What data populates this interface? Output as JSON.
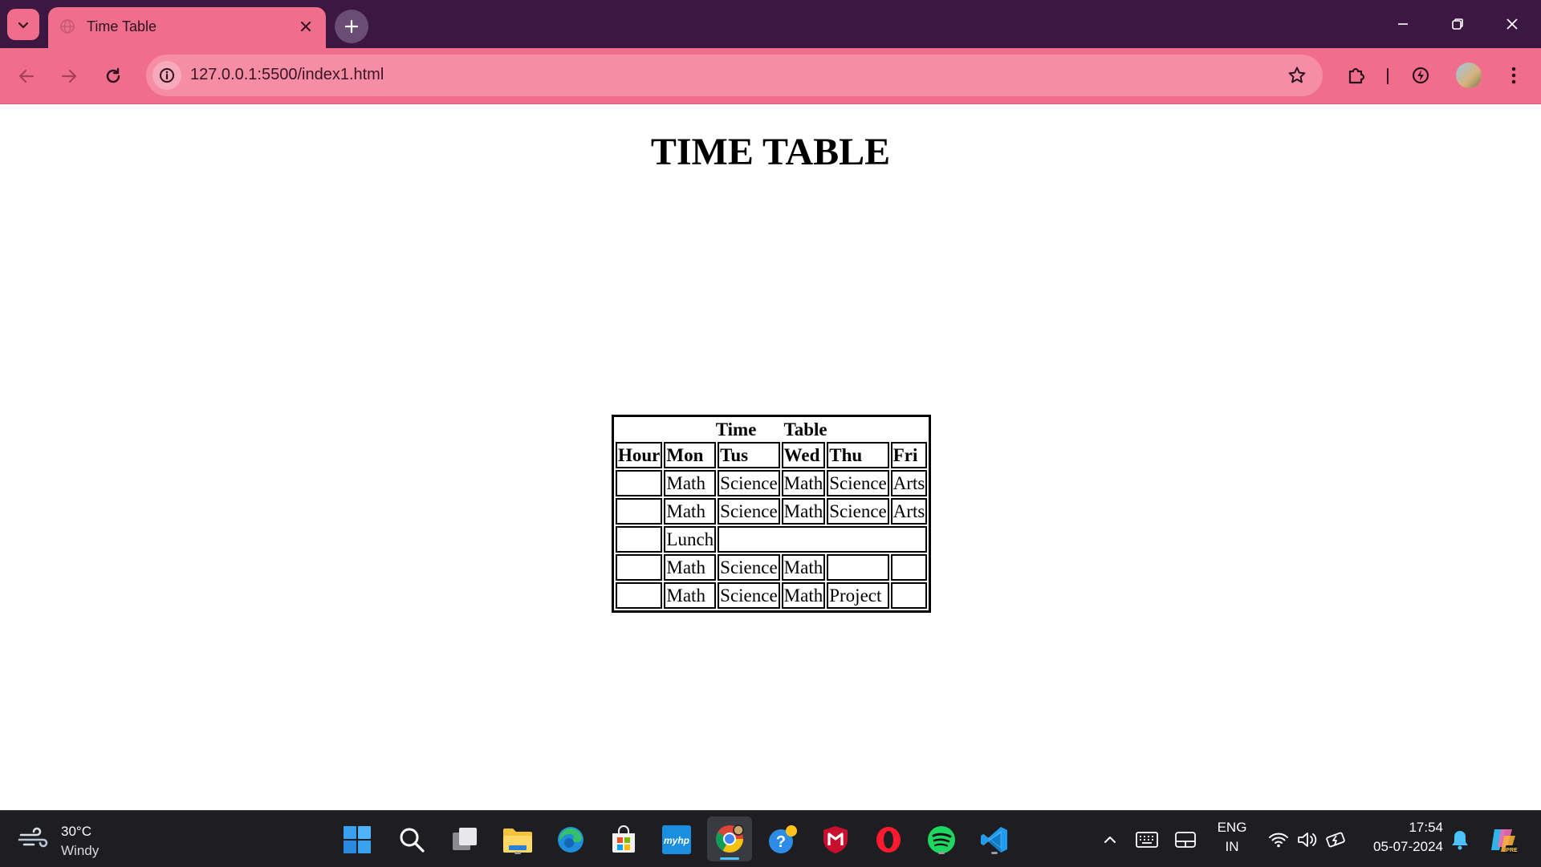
{
  "browser": {
    "tab_title": "Time Table",
    "url": "127.0.0.1:5500/index1.html"
  },
  "page": {
    "heading": "TIME TABLE",
    "table": {
      "caption_part1": "Time",
      "caption_part2": "Table",
      "headers": [
        "Hour",
        "Mon",
        "Tus",
        "Wed",
        "Thu",
        "Fri"
      ],
      "rows": [
        [
          "",
          "Math",
          "Science",
          "Math",
          "Science",
          "Arts"
        ],
        [
          "",
          "Math",
          "Science",
          "Math",
          "Science",
          "Arts"
        ],
        [
          "",
          "Lunch",
          "",
          "",
          "",
          ""
        ],
        [
          "",
          "Math",
          "Science",
          "Math",
          "",
          ""
        ],
        [
          "",
          "Math",
          "Science",
          "Math",
          "Project",
          ""
        ]
      ]
    }
  },
  "taskbar": {
    "weather_temp": "30°C",
    "weather_condition": "Windy",
    "language_line1": "ENG",
    "language_line2": "IN",
    "time": "17:54",
    "date": "05-07-2024"
  },
  "colors": {
    "tab_strip": "#3b1742",
    "toolbar": "#f06e8c",
    "omnibox": "#f58ea5",
    "taskbar": "#1e1e22"
  }
}
